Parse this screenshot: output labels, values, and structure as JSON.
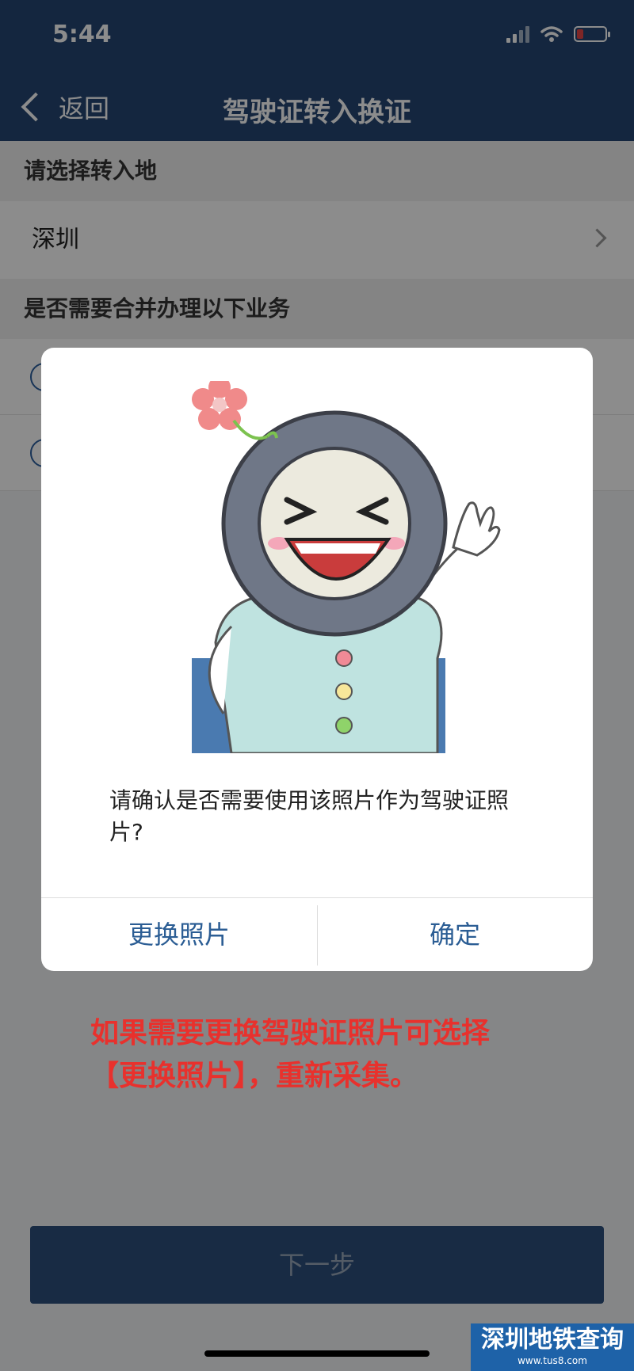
{
  "status_bar": {
    "time": "5:44"
  },
  "nav": {
    "back_label": "返回",
    "title": "驾驶证转入换证"
  },
  "section1": {
    "header": "请选择转入地",
    "city": "深圳"
  },
  "section2": {
    "header": "是否需要合并办理以下业务"
  },
  "dialog": {
    "message": "请确认是否需要使用该照片作为驾驶证照片?",
    "change_photo_label": "更换照片",
    "confirm_label": "确定"
  },
  "annotation": {
    "line1": "如果需要更换驾驶证照片可选择",
    "line2": "【更换照片】，重新采集。"
  },
  "footer": {
    "next_label": "下一步"
  },
  "watermark": {
    "main": "深圳地铁查询",
    "sub": "www.tus8.com"
  },
  "colors": {
    "nav_bg": "#254573",
    "accent": "#2b5d94",
    "annotation": "#e8312d"
  }
}
